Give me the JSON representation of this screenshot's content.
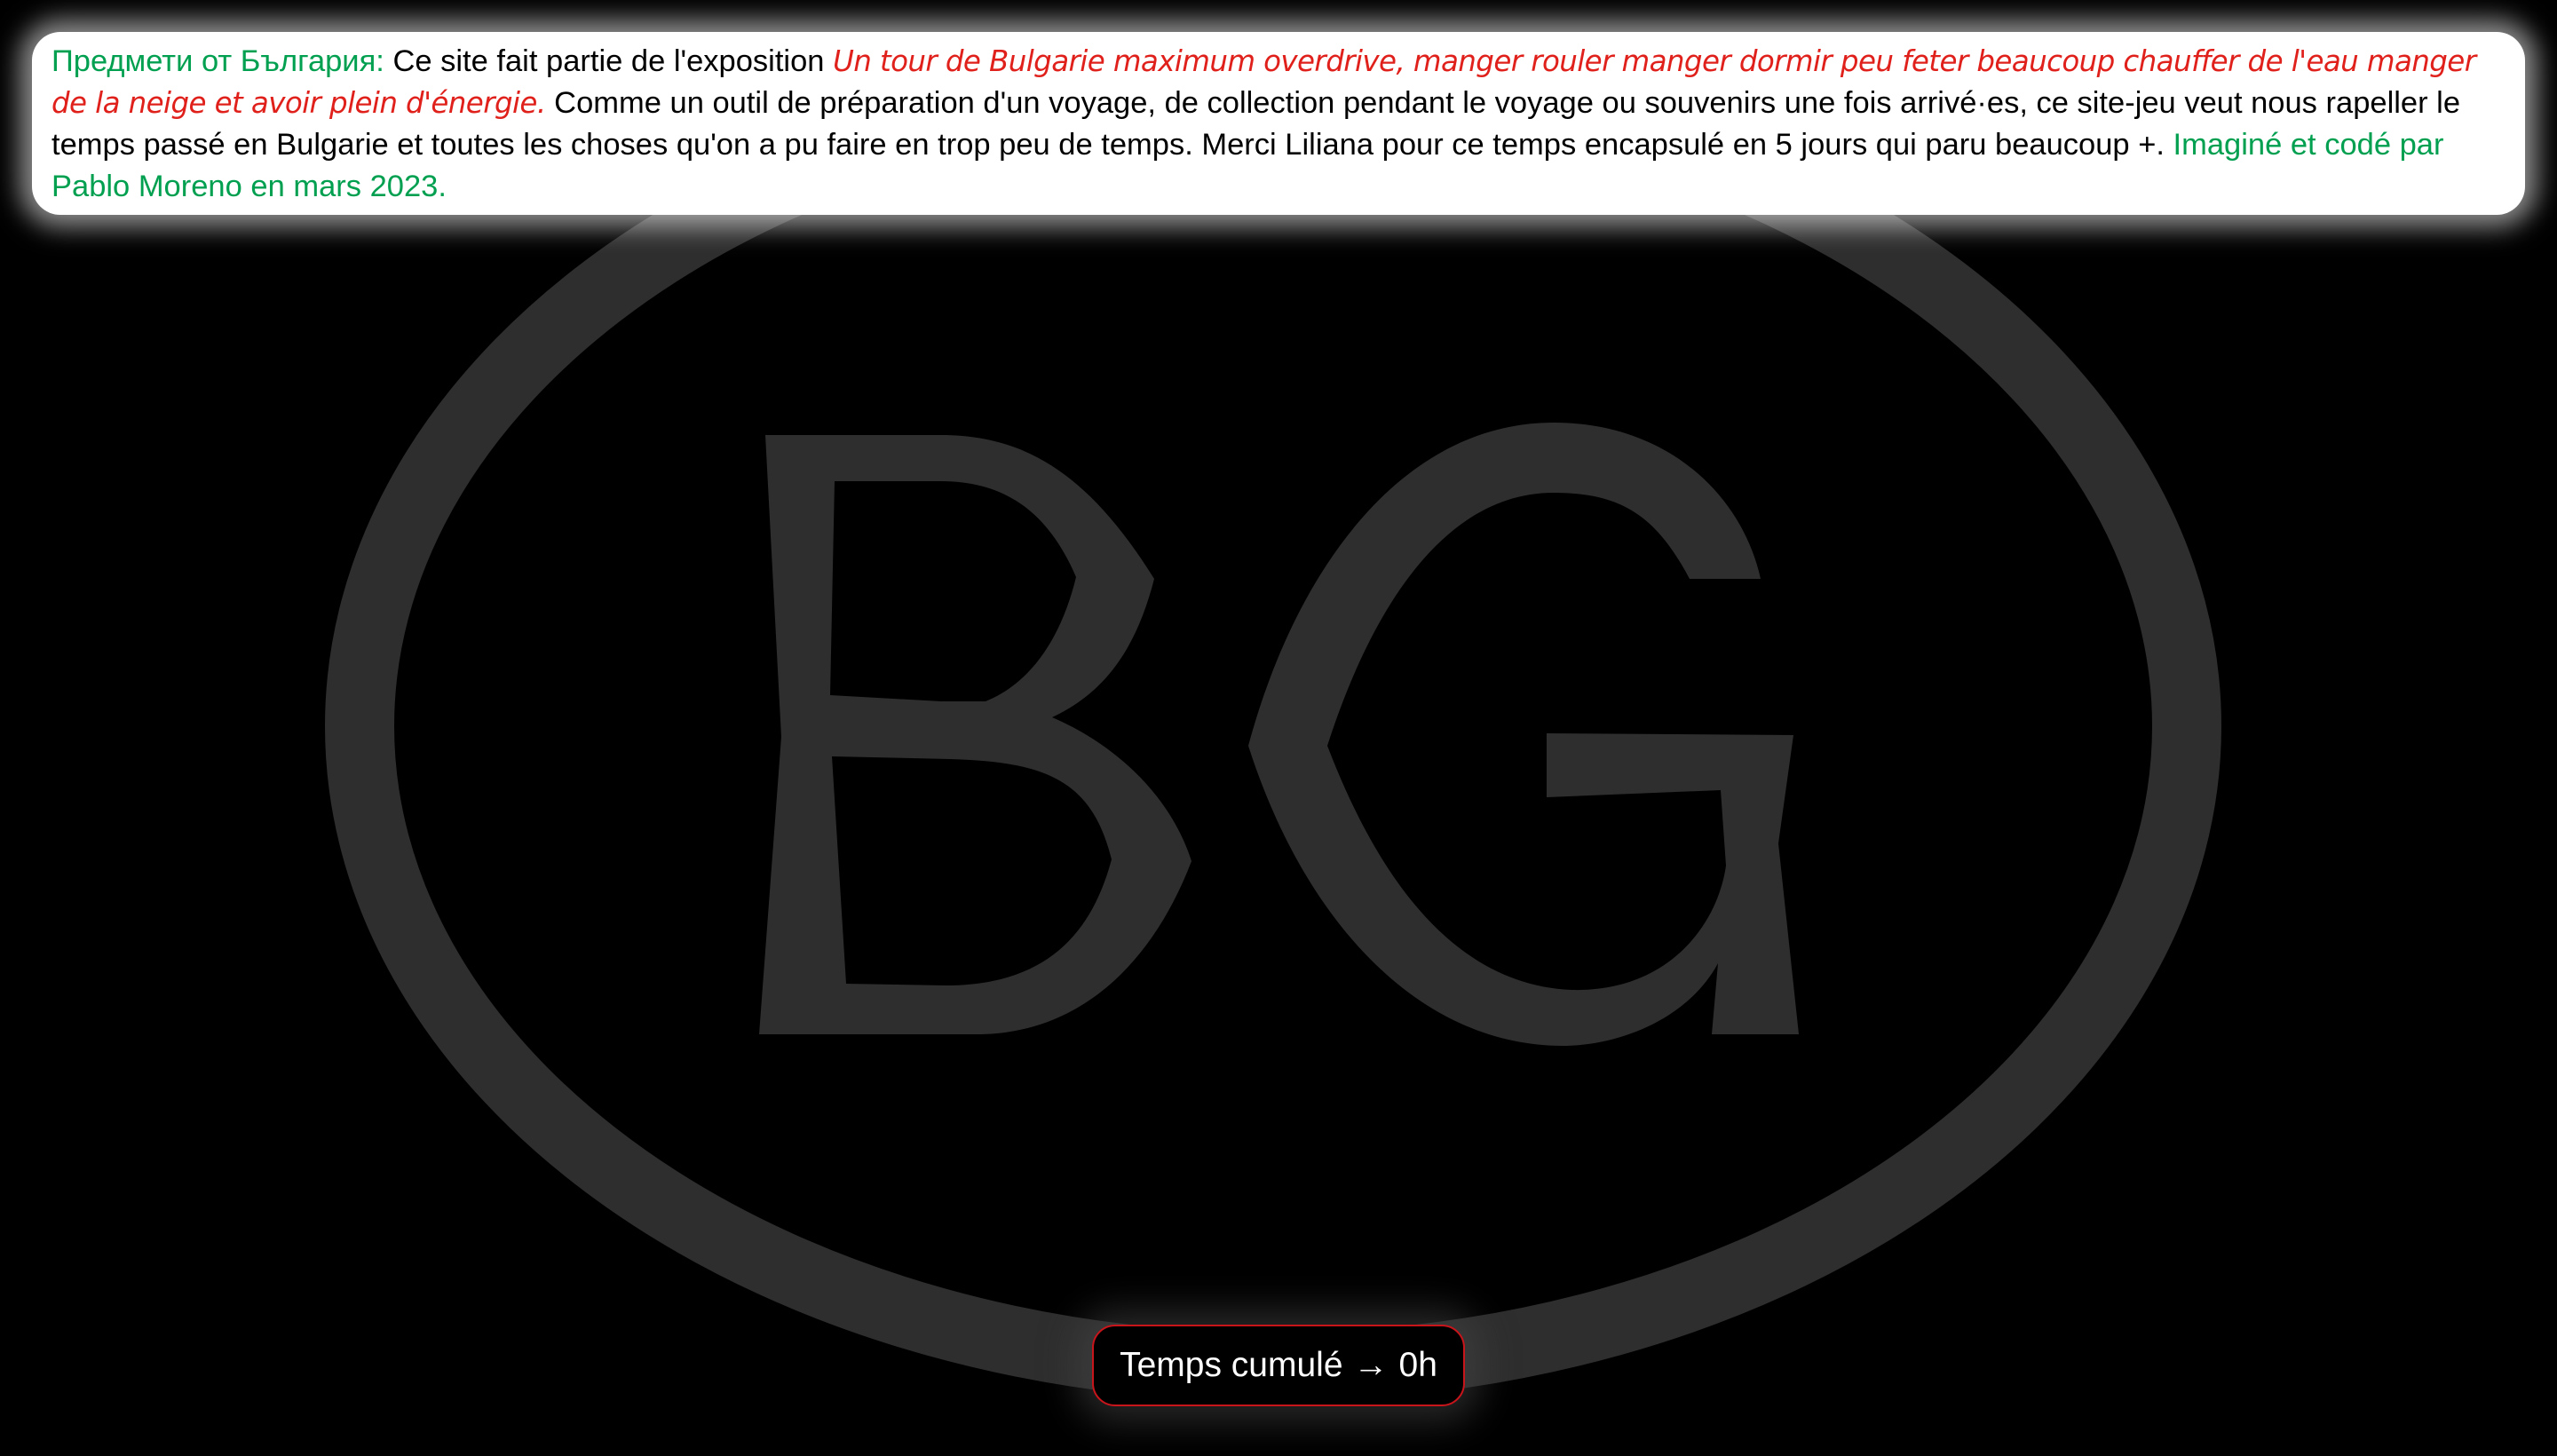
{
  "emblem": {
    "letters": "BG",
    "color": "#2e2e2e"
  },
  "intro": {
    "site_title": "Предмети от България:",
    "lead_text": "Ce site fait partie de l'exposition",
    "exhibition_title": "Un tour de Bulgarie maximum overdrive, manger rouler manger dormir peu feter beaucoup chauffer de l'eau manger de la neige et avoir plein d'énergie.",
    "description": "Comme un outil de préparation d'un voyage, de collection pendant le voyage ou souvenirs une fois arrivé·es, ce site-jeu veut nous rapeller le temps passé en Bulgarie et toutes les choses qu'on a pu faire en trop peu de temps. Merci Liliana pour ce temps encapsulé en 5 jours qui paru beaucoup +.",
    "credit": "Imaginé et codé par Pablo Moreno en mars 2023."
  },
  "timer": {
    "label": "Temps cumulé",
    "arrow": "→",
    "value": "0h"
  },
  "colors": {
    "accent_green": "#00a050",
    "accent_red": "#e0201b",
    "timer_border": "#c8141b",
    "background": "#000000"
  }
}
